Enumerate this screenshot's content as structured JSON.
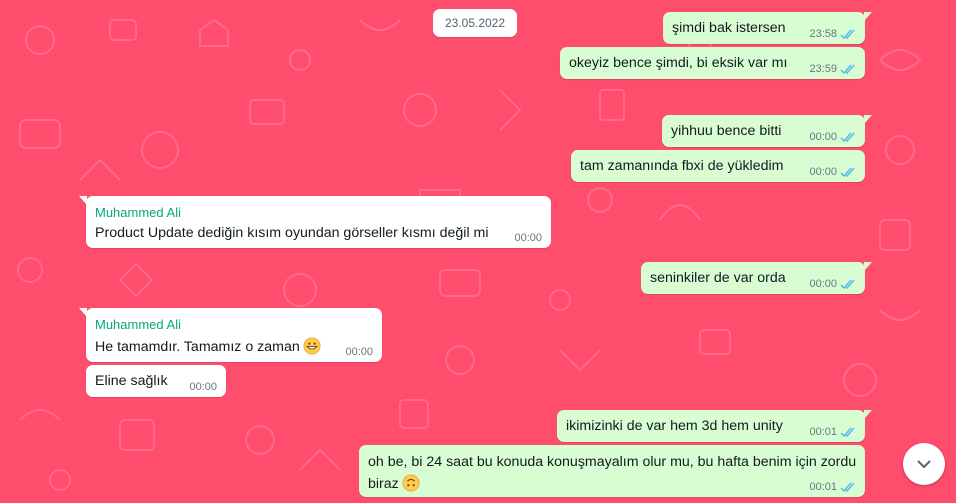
{
  "chat": {
    "date_label": "23.05.2022",
    "messages": [
      {
        "direction": "out",
        "text": "şimdi bak istersen",
        "time": "23:58",
        "status": "read"
      },
      {
        "direction": "out",
        "text": "okeyiz bence şimdi, bi eksik var mı",
        "time": "23:59",
        "status": "read"
      },
      {
        "direction": "out",
        "text": "yihhuu bence bitti",
        "time": "00:00",
        "status": "read"
      },
      {
        "direction": "out",
        "text": "tam zamanında fbxi de yükledim",
        "time": "00:00",
        "status": "read"
      },
      {
        "direction": "in",
        "sender": "Muhammed Ali",
        "text": "Product Update dediğin kısım oyundan görseller kısmı değil mi",
        "time": "00:00"
      },
      {
        "direction": "out",
        "text": "seninkiler de var orda",
        "time": "00:00",
        "status": "read"
      },
      {
        "direction": "in",
        "sender": "Muhammed Ali",
        "text": "He tamamdır. Tamamız o zaman",
        "emoji": "grinning-face",
        "time": "00:00"
      },
      {
        "direction": "in",
        "text": "Eline sağlık",
        "time": "00:00"
      },
      {
        "direction": "out",
        "text": "ikimizinki de var hem 3d hem unity",
        "time": "00:01",
        "status": "read"
      },
      {
        "direction": "out",
        "text_line1": "oh be, bi 24 saat bu konuda konuşmayalım olur mu, bu hafta benim için zordu",
        "text_line2": "biraz",
        "emoji": "upside-down-face",
        "time": "00:01",
        "status": "read"
      }
    ]
  },
  "controls": {
    "scroll_down_icon": "chevron-down-icon"
  },
  "colors": {
    "wallpaper": "#ff4d6d",
    "outgoing": "#d9fdd3",
    "incoming": "#ffffff",
    "sender_name": "#06a77d",
    "read_tick": "#53bdeb"
  }
}
